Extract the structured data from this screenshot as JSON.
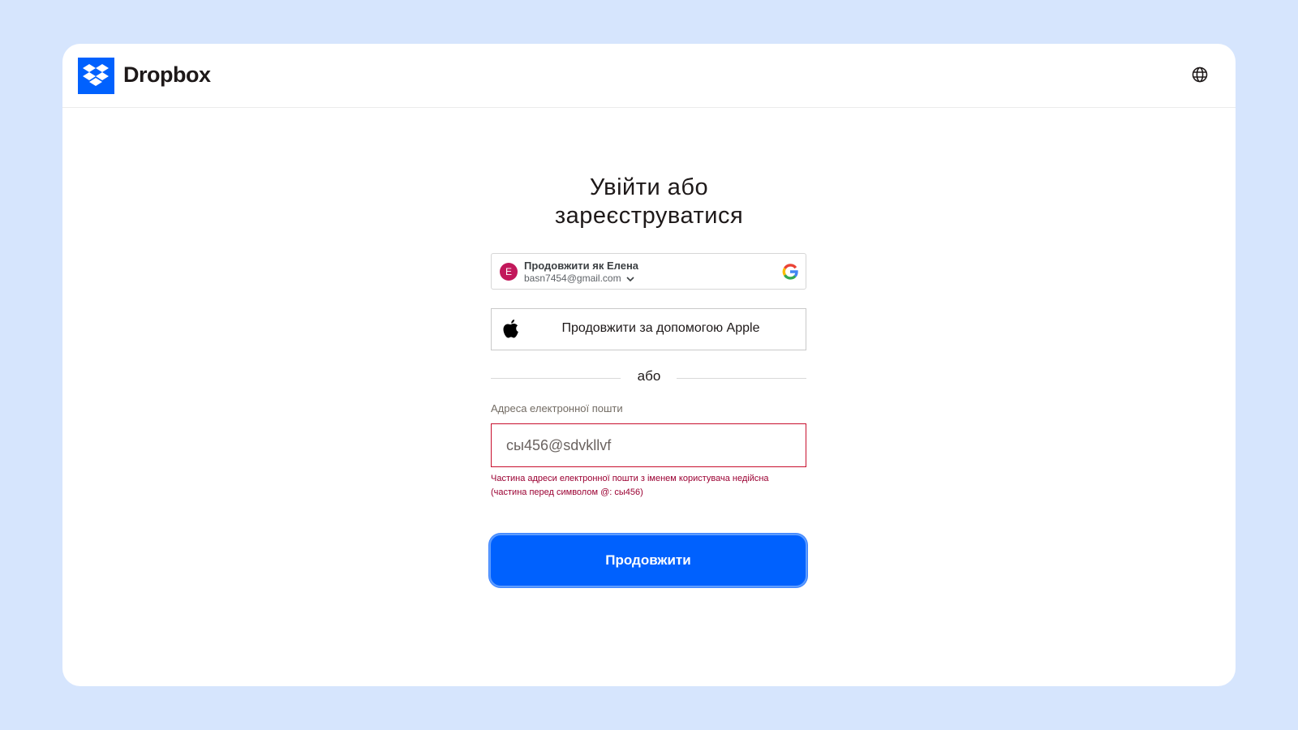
{
  "header": {
    "brand": "Dropbox"
  },
  "main": {
    "title_line1": "Увійти або",
    "title_line2": "зареєструватися",
    "google": {
      "avatar_letter": "E",
      "continue_as": "Продовжити як Елена",
      "email": "basn7454@gmail.com"
    },
    "apple_label": "Продовжити за допомогою Apple",
    "divider": "або",
    "email": {
      "label": "Адреса електронної пошти",
      "value": "сы456@sdvkllvf",
      "error": "Частина адреси електронної пошти з іменем користувача недійсна (частина перед символом @: сы456)"
    },
    "continue_label": "Продовжити"
  },
  "colors": {
    "page_background": "#d6e5fd",
    "brand_blue": "#0061fe",
    "error": "#9b0032",
    "avatar": "#c2185b"
  },
  "icons": {
    "logo": "dropbox-logo-icon",
    "globe": "globe-icon",
    "google": "google-icon",
    "apple": "apple-icon",
    "chevron": "chevron-down-icon"
  }
}
